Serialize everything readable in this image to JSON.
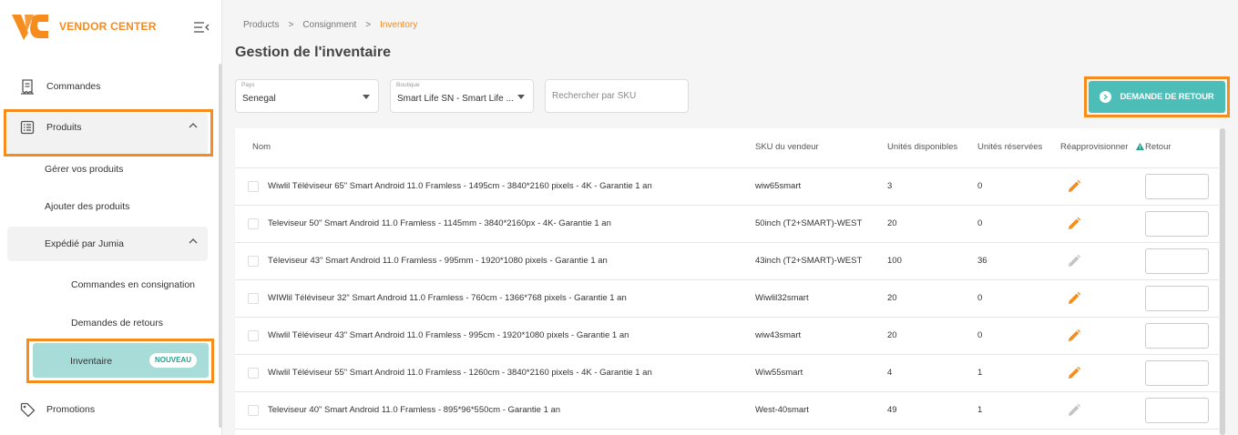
{
  "brand": {
    "name": "VENDOR CENTER",
    "accent": "#f68b1e",
    "teal": "#4dbdb7"
  },
  "sidebar": {
    "commandes": "Commandes",
    "produits": "Produits",
    "gerer": "Gérer vos produits",
    "ajouter": "Ajouter des produits",
    "expedie": "Expédié par Jumia",
    "consignation": "Commandes en consignation",
    "retours": "Demandes de retours",
    "inventaire": "Inventaire",
    "badge": "NOUVEAU",
    "promotions": "Promotions"
  },
  "breadcrumb": [
    "Products",
    ">",
    "Consignment",
    ">",
    "Inventory"
  ],
  "page_title": "Gestion de l'inventaire",
  "filters": {
    "pays_label": "Pays",
    "pays_value": "Senegal",
    "boutique_label": "Boutique",
    "boutique_value": "Smart Life SN - Smart Life ...",
    "sku_placeholder": "Rechercher par SKU"
  },
  "return_button": "DEMANDE DE RETOUR",
  "table": {
    "headers": {
      "nom": "Nom",
      "sku": "SKU du vendeur",
      "dispo": "Unités disponibles",
      "reserve": "Unités réservées",
      "reappro": "Réapprovisionner",
      "retour": "Retour"
    },
    "rows": [
      {
        "name": "Wiwlil Téléviseur 65\" Smart Android 11.0 Framless - 1495cm - 3840*2160 pixels - 4K - Garantie 1 an",
        "sku": "wiw65smart",
        "dispo": "3",
        "reserve": "0",
        "edit_enabled": true
      },
      {
        "name": "Televiseur 50\" Smart Android 11.0 Framless - 1145mm - 3840*2160px - 4K- Garantie 1 an",
        "sku": "50inch (T2+SMART)-WEST",
        "dispo": "20",
        "reserve": "0",
        "edit_enabled": true
      },
      {
        "name": "Téleviseur 43\" Smart Android 11.0 Framless - 995mm - 1920*1080 pixels - Garantie 1 an",
        "sku": "43inch (T2+SMART)-WEST",
        "dispo": "100",
        "reserve": "36",
        "edit_enabled": false
      },
      {
        "name": "WIWlil Téléviseur 32\" Smart Android 11.0 Framless - 760cm - 1366*768 pixels - Garantie 1 an",
        "sku": "Wiwlil32smart",
        "dispo": "20",
        "reserve": "0",
        "edit_enabled": true
      },
      {
        "name": "Wiwlil Téléviseur 43\" Smart Android 11.0 Framless - 995cm - 1920*1080 pixels - Garantie 1 an",
        "sku": "wiw43smart",
        "dispo": "20",
        "reserve": "0",
        "edit_enabled": true
      },
      {
        "name": "Wiwlil Téléviseur 55\" Smart Android 11.0 Framless - 1260cm - 3840*2160 pixels - 4K - Garantie 1 an",
        "sku": "Wiw55smart",
        "dispo": "4",
        "reserve": "1",
        "edit_enabled": true
      },
      {
        "name": "Televiseur 40\" Smart Android 11.0 Framless - 895*96*550cm - Garantie 1 an",
        "sku": "West-40smart",
        "dispo": "49",
        "reserve": "1",
        "edit_enabled": false
      }
    ]
  }
}
